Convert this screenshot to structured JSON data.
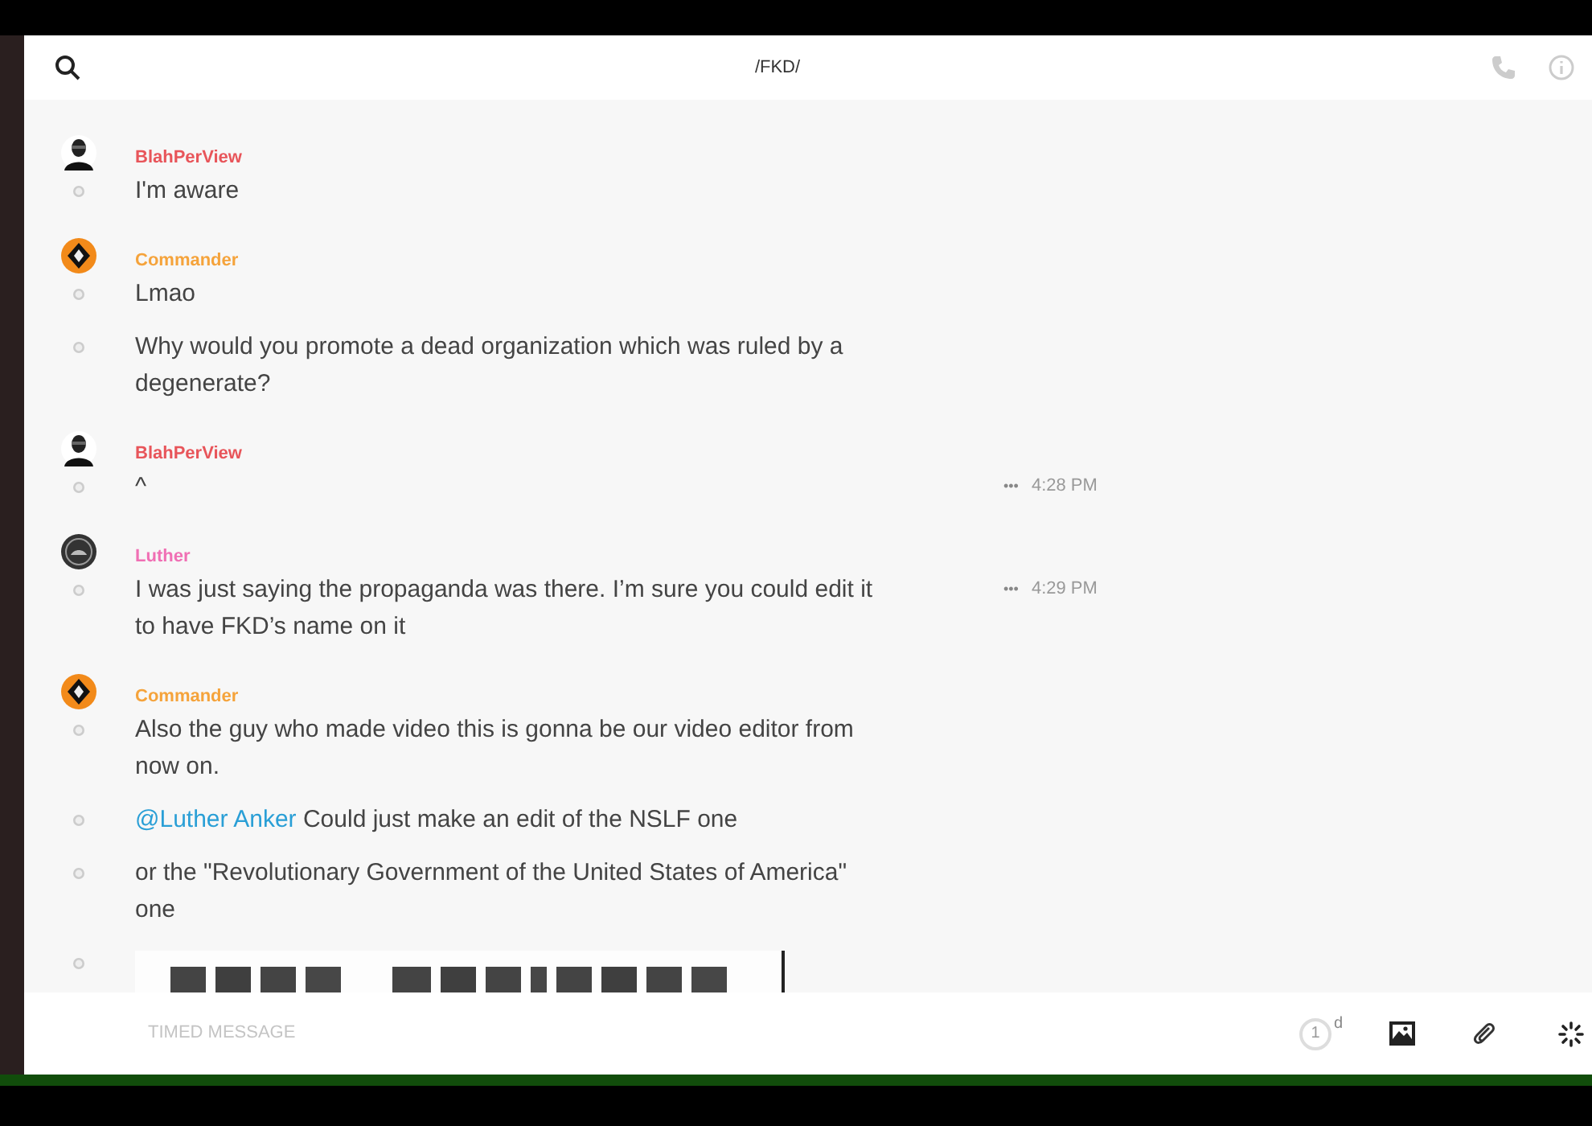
{
  "header": {
    "title": "/FKD/"
  },
  "groups": [
    {
      "author": "BlahPerView",
      "color": "#e8555a",
      "kind": "masked",
      "lines": [
        {
          "kind": "text",
          "text": "I'm aware"
        }
      ]
    },
    {
      "author": "Commander",
      "color": "#f5a33b",
      "kind": "diamond",
      "lines": [
        {
          "kind": "text",
          "text": "Lmao"
        },
        {
          "kind": "text",
          "text": "Why would you promote a dead organization which was ruled by a degenerate?"
        }
      ]
    },
    {
      "author": "BlahPerView",
      "color": "#e8555a",
      "kind": "masked",
      "lines": [
        {
          "kind": "text",
          "text": "^",
          "menu": "•••",
          "time": "4:28 PM"
        }
      ]
    },
    {
      "author": "Luther",
      "color": "#f06fb4",
      "kind": "dark",
      "lines": [
        {
          "kind": "text",
          "text": "I was just saying the propaganda was there. I’m sure you could edit it to have FKD’s name on it",
          "menu": "•••",
          "time": "4:29 PM"
        }
      ]
    },
    {
      "author": "Commander",
      "color": "#f5a33b",
      "kind": "diamond",
      "lines": [
        {
          "kind": "text",
          "text": "Also the guy who made video this is gonna be our video editor from now on."
        },
        {
          "kind": "text",
          "mention": "@Luther Anker",
          "text": " Could just make an edit of the NSLF one"
        },
        {
          "kind": "text",
          "text": "or the \"Revolutionary Government of the United States of America\" one"
        },
        {
          "kind": "picture"
        }
      ]
    }
  ],
  "composer": {
    "placeholder": "TIMED MESSAGE",
    "timer": "1",
    "timer_unit": "d"
  }
}
